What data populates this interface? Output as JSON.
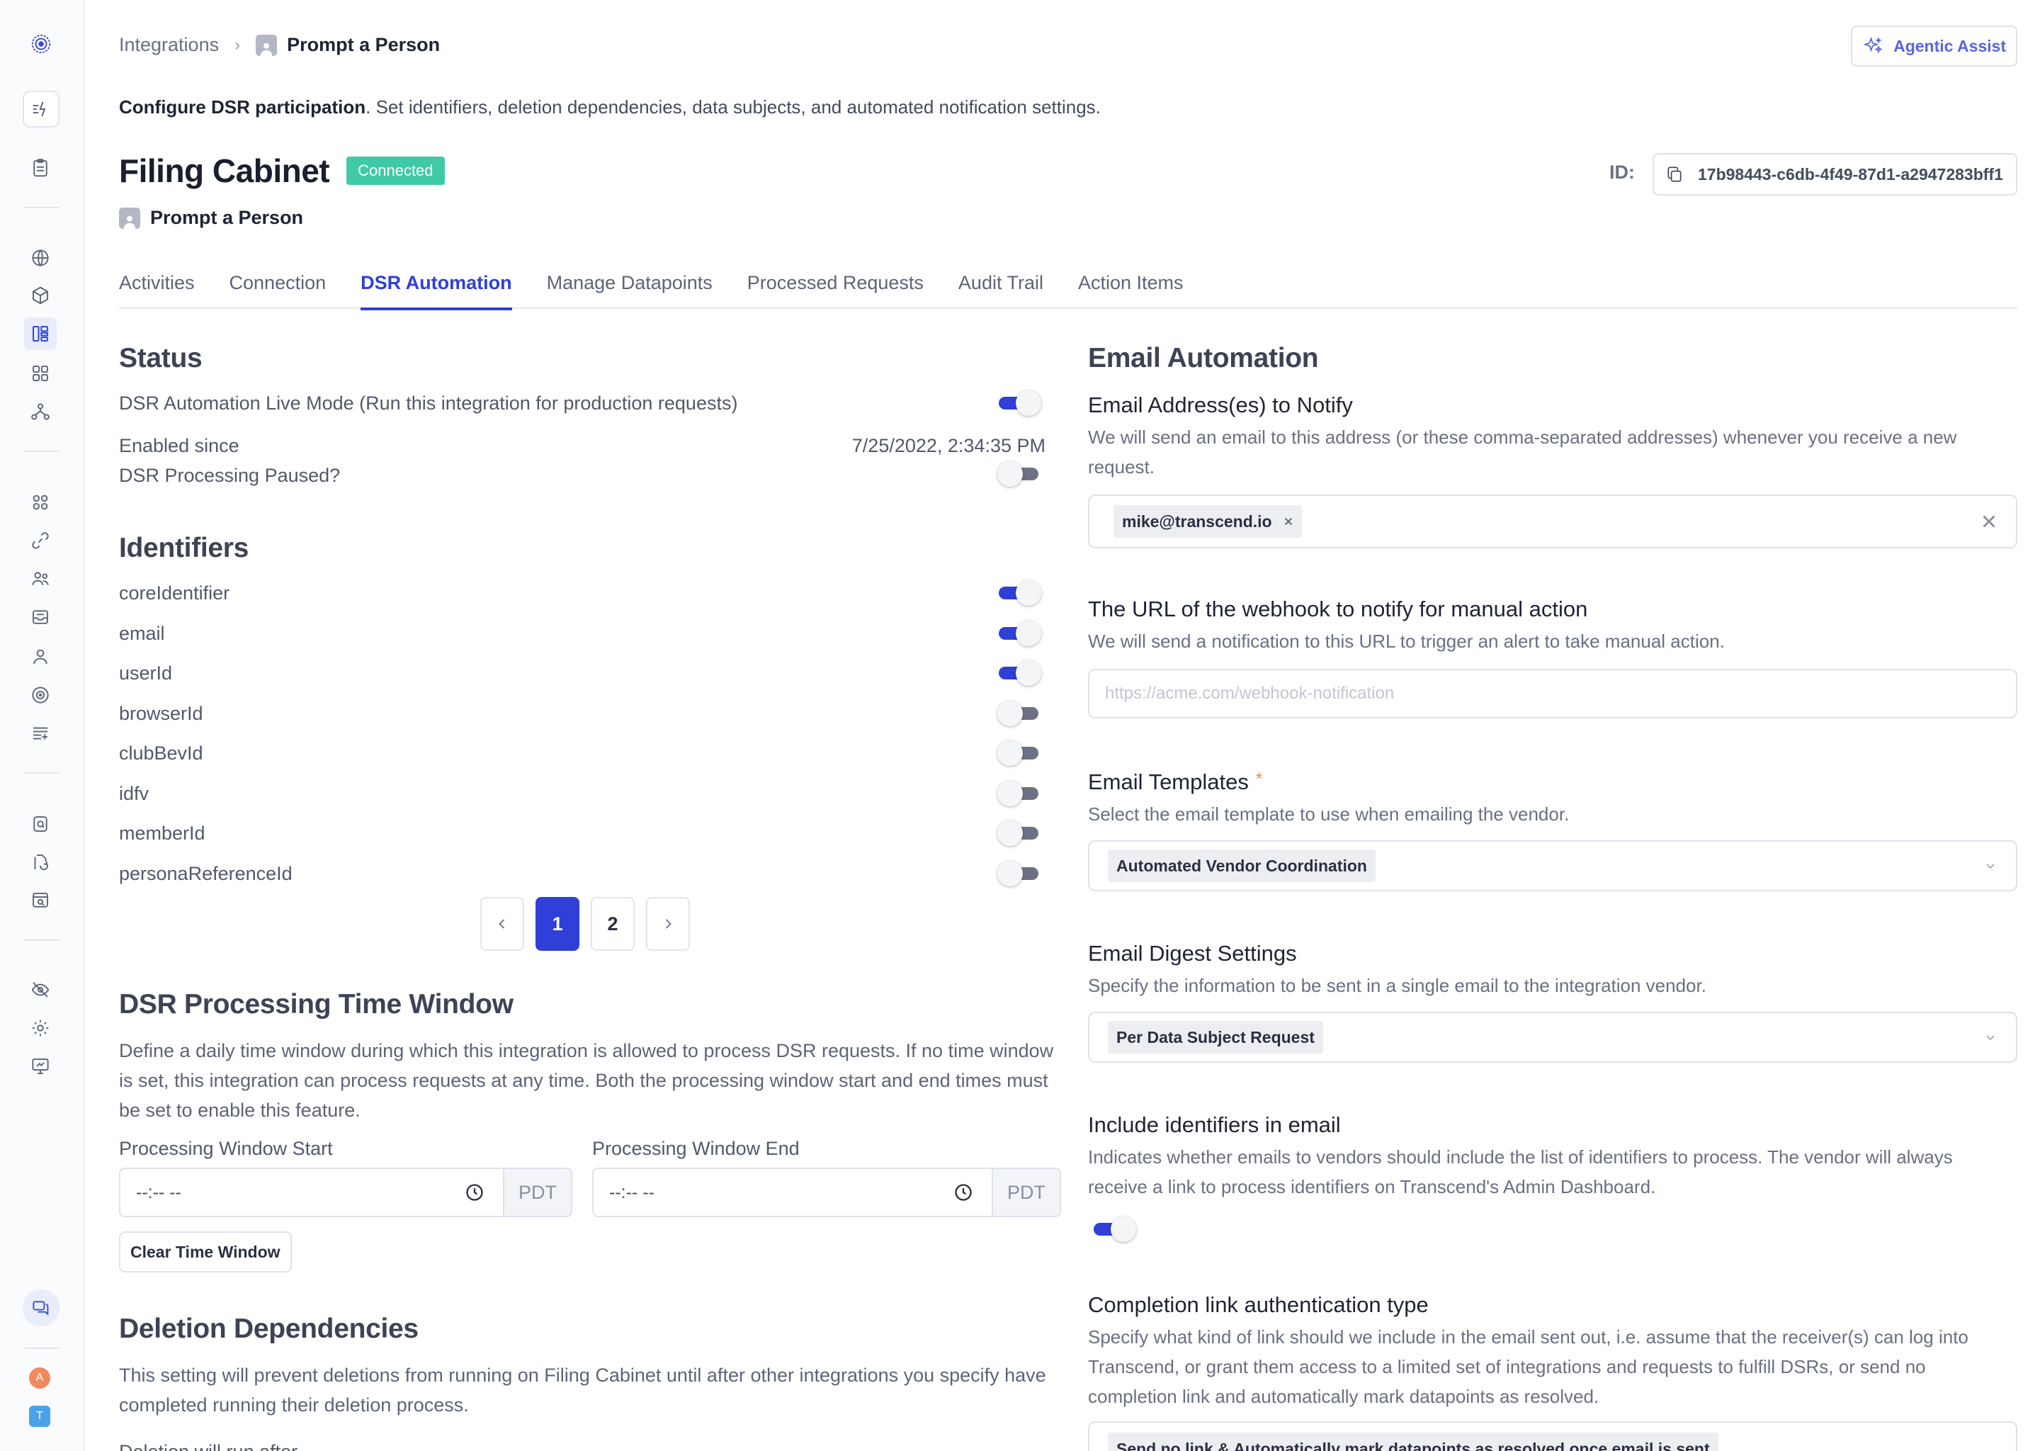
{
  "header": {
    "breadcrumb_root": "Integrations",
    "breadcrumb_sep": "›",
    "breadcrumb_current": "Prompt a Person",
    "assist_label": "Agentic Assist",
    "desc_bold": "Configure DSR participation",
    "desc_rest": ". Set identifiers, deletion dependencies, data subjects, and automated notification settings.",
    "title": "Filing Cabinet",
    "status": "Connected",
    "subtitle": "Prompt a Person",
    "id_label": "ID:",
    "id_value": "17b98443-c6db-4f49-87d1-a2947283bff1"
  },
  "sidebar": {
    "avatar_a": "A",
    "avatar_t": "T"
  },
  "tabs": [
    "Activities",
    "Connection",
    "DSR Automation",
    "Manage Datapoints",
    "Processed Requests",
    "Audit Trail",
    "Action Items"
  ],
  "status_section": {
    "heading": "Status",
    "live_mode_label": "DSR Automation Live Mode (Run this integration for production requests)",
    "live_mode_on": true,
    "enabled_since_label": "Enabled since",
    "enabled_since_value": "7/25/2022, 2:34:35 PM",
    "paused_label": "DSR Processing Paused?",
    "paused_on": false
  },
  "identifiers": {
    "heading": "Identifiers",
    "items": [
      {
        "name": "coreIdentifier",
        "on": true
      },
      {
        "name": "email",
        "on": true
      },
      {
        "name": "userId",
        "on": true
      },
      {
        "name": "browserId",
        "on": false
      },
      {
        "name": "clubBevId",
        "on": false
      },
      {
        "name": "idfv",
        "on": false
      },
      {
        "name": "memberId",
        "on": false
      },
      {
        "name": "personaReferenceId",
        "on": false
      }
    ],
    "pages": [
      "1",
      "2"
    ],
    "current_page": "1"
  },
  "time_window": {
    "heading": "DSR Processing Time Window",
    "description": "Define a daily time window during which this integration is allowed to process DSR requests. If no time window is set, this integration can process requests at any time. Both the processing window start and end times must be set to enable this feature.",
    "start_label": "Processing Window Start",
    "end_label": "Processing Window End",
    "start_value": "--:-- --",
    "end_value": "--:-- --",
    "tz": "PDT",
    "clear_label": "Clear Time Window"
  },
  "deletion": {
    "heading": "Deletion Dependencies",
    "description": "This setting will prevent deletions from running on Filing Cabinet until after other integrations you specify have completed running their deletion process.",
    "run_after_label": "Deletion will run after"
  },
  "email_automation": {
    "heading": "Email Automation",
    "notify_label": "Email Address(es) to Notify",
    "notify_help": "We will send an email to this address (or these comma-separated addresses) whenever you receive a new request.",
    "notify_chip": "mike@transcend.io",
    "webhook_label": "The URL of the webhook to notify for manual action",
    "webhook_help": "We will send a notification to this URL to trigger an alert to take manual action.",
    "webhook_placeholder": "https://acme.com/webhook-notification",
    "templates_label": "Email Templates",
    "templates_required": "*",
    "templates_help": "Select the email template to use when emailing the vendor.",
    "templates_value": "Automated Vendor Coordination",
    "digest_label": "Email Digest Settings",
    "digest_help": "Specify the information to be sent in a single email to the integration vendor.",
    "digest_value": "Per Data Subject Request",
    "include_ids_label": "Include identifiers in email",
    "include_ids_help": "Indicates whether emails to vendors should include the list of identifiers to process. The vendor will always receive a link to process identifiers on Transcend's Admin Dashboard.",
    "include_ids_on": true,
    "completion_label": "Completion link authentication type",
    "completion_help": "Specify what kind of link should we include in the email sent out, i.e. assume that the receiver(s) can log into Transcend, or grant them access to a limited set of integrations and requests to fulfill DSRs, or send no completion link and automatically mark datapoints as resolved.",
    "completion_value": "Send no link & Automatically mark datapoints as resolved once email is sent"
  },
  "colors": {
    "accent": "#2f3fd8",
    "connected": "#3fcaa5",
    "required": "#f08a3c",
    "avatar_a": "#f08a5d",
    "avatar_t": "#4aa3e8"
  },
  "icons": {
    "logo": "logo-icon",
    "assist": "sparkle-icon",
    "copy": "copy-icon",
    "clock": "clock-icon",
    "close": "close-icon",
    "chevron": "chevron-down-icon"
  }
}
